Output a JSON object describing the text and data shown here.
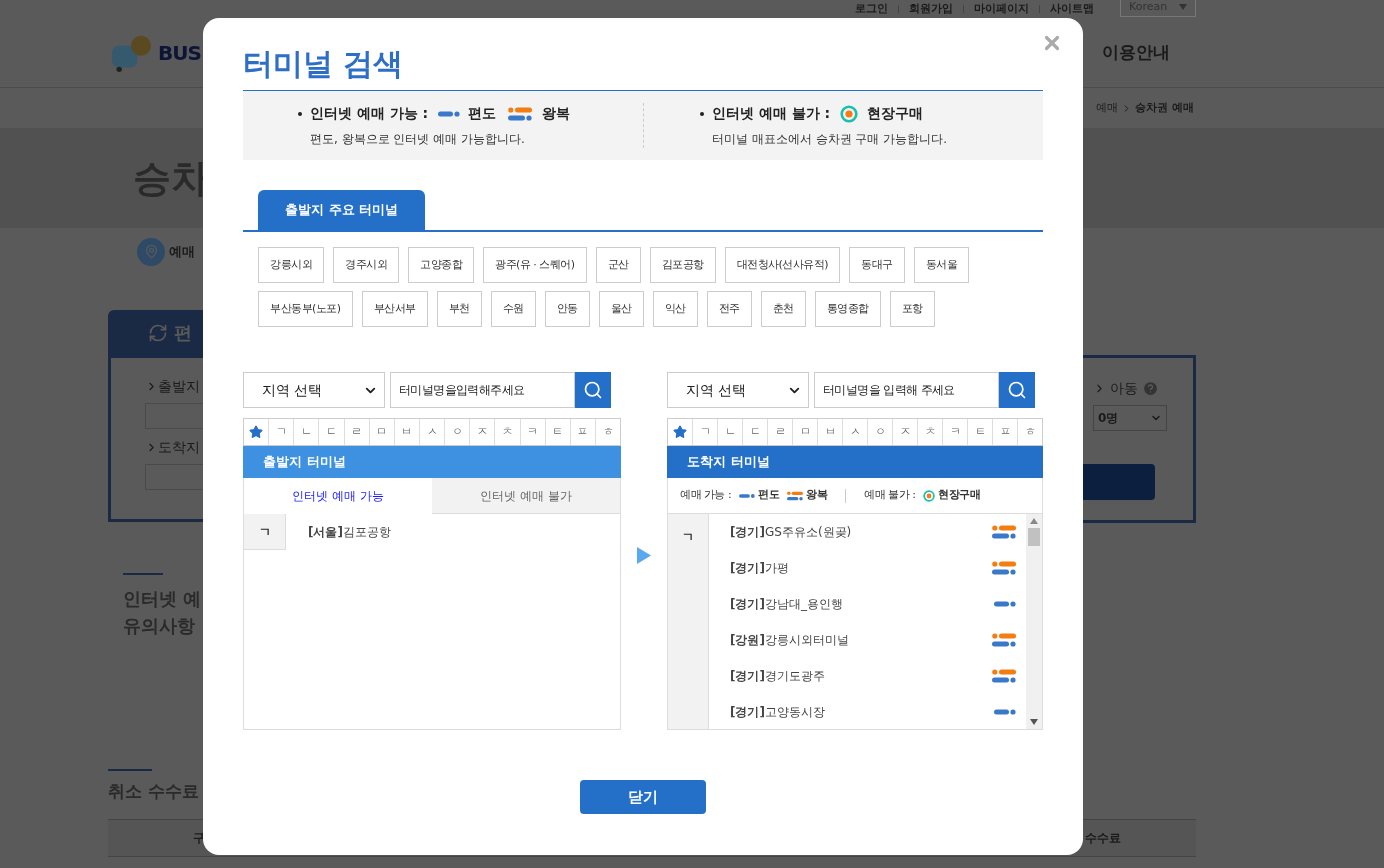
{
  "background": {
    "util_links": [
      "로그인",
      "회원가입",
      "마이페이지",
      "사이트맵"
    ],
    "language": "Korean",
    "logo_text": "BUS",
    "nav_item": "이용안내",
    "breadcrumb": [
      "예매",
      "승차권 예매"
    ],
    "page_title": "승차",
    "section_tab": "예매",
    "trip_tab": "편",
    "fields": [
      "출발지",
      "도착지"
    ],
    "child_label": "아동",
    "child_count": "0명",
    "notice_title": [
      "인터넷 예",
      "유의사항"
    ],
    "fee_title": "취소 수수료",
    "fee_table_columns": [
      "구",
      "수수료"
    ]
  },
  "modal": {
    "title": "터미널 검색",
    "legend": {
      "available": {
        "label": "인터넷 예매 가능 :",
        "oneway": "편도",
        "round": "왕복",
        "note": "편도, 왕복으로 인터넷 예매 가능합니다."
      },
      "unavailable": {
        "label": "인터넷 예매 불가 :",
        "onsite": "현장구매",
        "note": "터미널 매표소에서 승차권 구매 가능합니다."
      }
    },
    "tab": "출발지 주요 터미널",
    "major_terminal_rows": [
      [
        "강릉시외",
        "경주시외",
        "고양종합",
        "광주(유 · 스퀘어)",
        "군산",
        "김포공항",
        "대전청사(선사유적)",
        "동대구",
        "동서울"
      ],
      [
        "부산동부(노포)",
        "부산서부",
        "부천",
        "수원",
        "안동",
        "울산",
        "익산",
        "전주",
        "춘천",
        "통영종합",
        "포항"
      ]
    ],
    "departure": {
      "region_select": "지역 선택",
      "search_placeholder": "터미널명을입력해주세요",
      "consonants": [
        "ㄱ",
        "ㄴ",
        "ㄷ",
        "ㄹ",
        "ㅁ",
        "ㅂ",
        "ㅅ",
        "ㅇ",
        "ㅈ",
        "ㅊ",
        "ㅋ",
        "ㅌ",
        "ㅍ",
        "ㅎ"
      ],
      "header": "출발지 터미널",
      "filter_tabs": [
        {
          "label": "인터넷 예매 가능",
          "selected": true
        },
        {
          "label": "인터넷 예매 불가",
          "selected": false
        }
      ],
      "groups": [
        {
          "index": "ㄱ",
          "terminals": [
            {
              "name": "**[서울]**김포공항"
            }
          ]
        }
      ]
    },
    "arrival": {
      "region_select": "지역 선택",
      "search_placeholder": "터미널명을 입력해 주세요",
      "consonants": [
        "ㄱ",
        "ㄴ",
        "ㄷ",
        "ㄹ",
        "ㅁ",
        "ㅂ",
        "ㅅ",
        "ㅇ",
        "ㅈ",
        "ㅊ",
        "ㅋ",
        "ㅌ",
        "ㅍ",
        "ㅎ"
      ],
      "header": "도착지 터미널",
      "legend": {
        "available_label": "예매 가능 :",
        "oneway": "편도",
        "round": "왕복",
        "unavailable_label": "예매 불가 :",
        "onsite": "현장구매"
      },
      "groups": [
        {
          "index": "ㄱ",
          "terminals": [
            {
              "name": "**[경기]**GS주유소(원곶)",
              "kind": "round"
            },
            {
              "name": "**[경기]**가평",
              "kind": "round"
            },
            {
              "name": "**[경기]**강남대_용인행",
              "kind": "oneway"
            },
            {
              "name": "**[강원]**강릉시외터미널",
              "kind": "round"
            },
            {
              "name": "**[경기]**경기도광주",
              "kind": "round"
            },
            {
              "name": "**[경기]**고양동시장",
              "kind": "oneway"
            }
          ]
        }
      ]
    },
    "close_button": "닫기"
  }
}
